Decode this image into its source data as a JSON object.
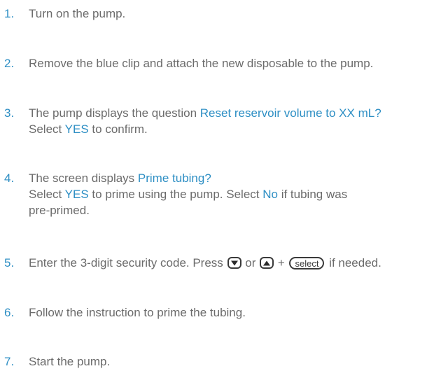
{
  "steps": [
    {
      "num": "1.",
      "line1": "Turn on the pump."
    },
    {
      "num": "2.",
      "line1": "Remove the blue clip and attach the new disposable to the pump."
    },
    {
      "num": "3.",
      "line1_pre": "The pump displays the question ",
      "line1_hl": "Reset reservoir volume to XX mL?",
      "line2_pre": "Select ",
      "line2_hl": "YES",
      "line2_post": " to confirm."
    },
    {
      "num": "4.",
      "line1_pre": "The screen displays ",
      "line1_hl": "Prime tubing?",
      "line2_pre": "Select ",
      "line2_hl": "YES",
      "line2_mid": " to prime using the pump. Select ",
      "line2_hl2": "No",
      "line2_post": " if tubing was",
      "line3": "pre-primed."
    },
    {
      "num": "5.",
      "line1_pre": "Enter the 3-digit security code. Press ",
      "or": " or ",
      "plus": " + ",
      "select_label": "select",
      "line1_post": " if needed."
    },
    {
      "num": "6.",
      "line1": "Follow the instruction to prime the tubing."
    },
    {
      "num": "7.",
      "line1": "Start the pump."
    }
  ],
  "icons": {
    "down": "down-arrow-button-icon",
    "up": "up-arrow-button-icon",
    "select": "select-button-icon"
  },
  "colors": {
    "accent": "#2e8fc4",
    "text": "#6b6b6b"
  }
}
